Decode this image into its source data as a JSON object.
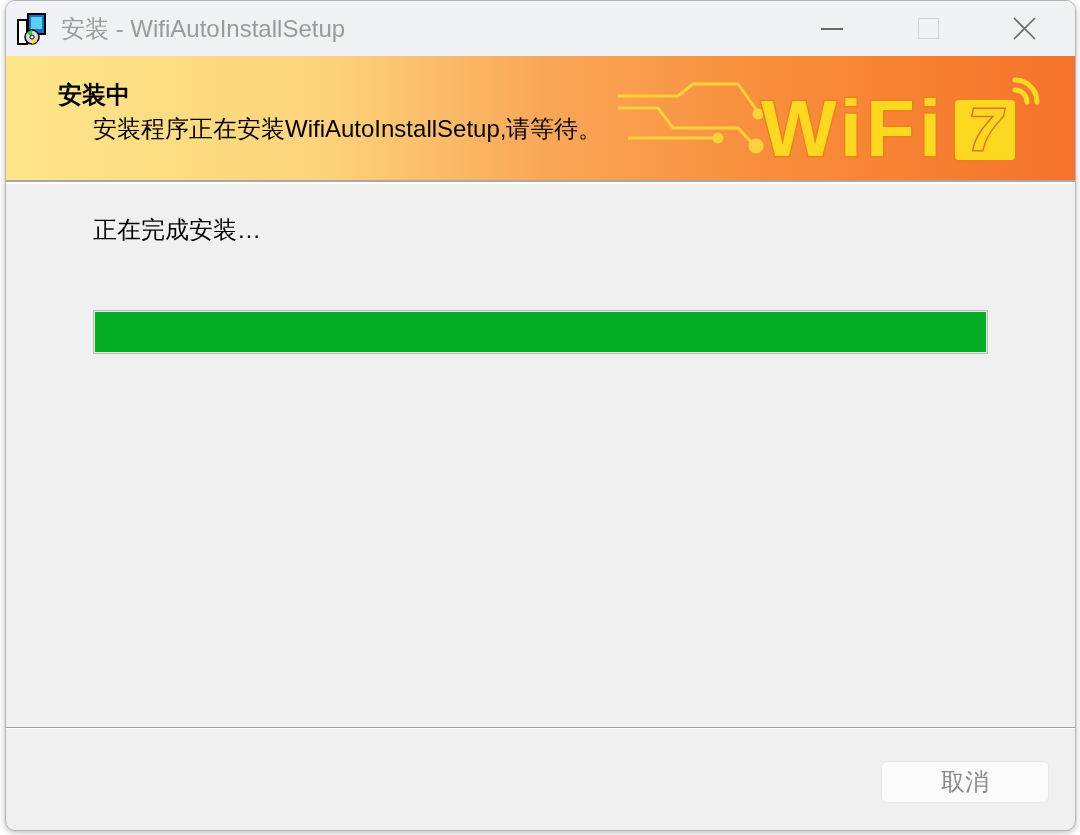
{
  "window": {
    "title": "安装 - WifiAutoInstallSetup",
    "title_buttons": [
      {
        "kind": "minimize",
        "disabled": false
      },
      {
        "kind": "maximize",
        "disabled": true
      },
      {
        "kind": "close",
        "disabled": false
      }
    ]
  },
  "banner": {
    "heading": "安装中",
    "subheading": "安装程序正在安装WifiAutoInstallSetup,请等待。",
    "logo": {
      "text": "WiFi",
      "badge": "7"
    }
  },
  "status": {
    "text": "正在完成安装…",
    "progress": {
      "level": 1
    }
  },
  "buttons": [
    {
      "label": "取消",
      "disabled": true
    }
  ]
}
